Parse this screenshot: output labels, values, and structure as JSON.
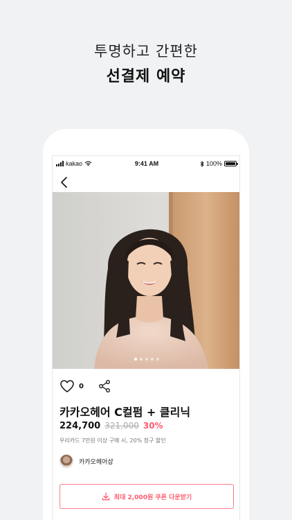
{
  "headline": {
    "line1": "투명하고 간편한",
    "line2": "선결제 예약"
  },
  "status_bar": {
    "carrier": "kakao",
    "time": "9:41 AM",
    "battery": "100%"
  },
  "product": {
    "like_count": "0",
    "title": "카카오헤어 C컬펌 + 클리닉",
    "price": "224,700",
    "original_price": "321,000",
    "discount": "30%",
    "benefit": "우리카드 7만원 이상 구매 시, 20% 청구 할인",
    "image_pager": {
      "total": 5,
      "active": 1
    }
  },
  "seller": {
    "name": "카카오헤어샵"
  },
  "coupon_button": {
    "label": "최대 2,000원 쿠폰 다운받기"
  },
  "colors": {
    "background": "#f1f2f4",
    "accent": "#ff5a6e"
  },
  "icons": [
    "back-arrow-icon",
    "heart-icon",
    "share-icon",
    "download-icon",
    "wifi-icon",
    "bluetooth-icon",
    "battery-icon",
    "signal-icon"
  ]
}
